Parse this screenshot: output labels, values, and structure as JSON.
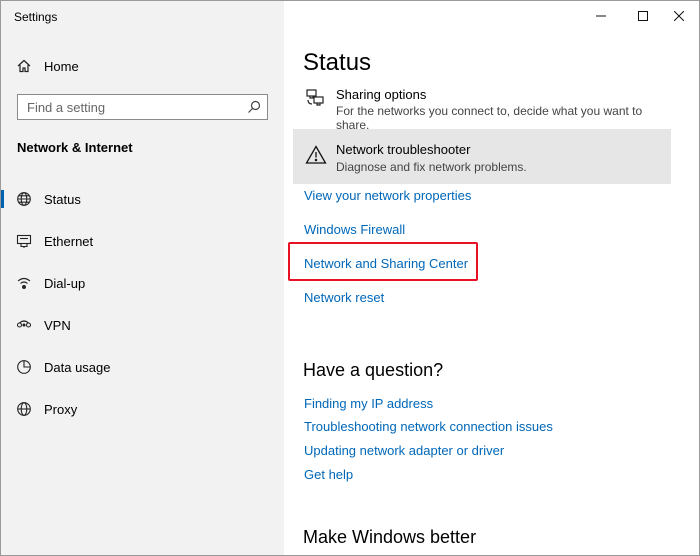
{
  "window": {
    "title": "Settings",
    "minimize_icon": "minimize-icon",
    "maximize_icon": "maximize-icon",
    "close_icon": "close-icon"
  },
  "sidebar": {
    "home_label": "Home",
    "search_placeholder": "Find a setting",
    "section_header": "Network & Internet",
    "items": [
      {
        "label": "Status",
        "icon": "globe-network-icon",
        "active": true
      },
      {
        "label": "Ethernet",
        "icon": "ethernet-icon"
      },
      {
        "label": "Dial-up",
        "icon": "dial-up-icon"
      },
      {
        "label": "VPN",
        "icon": "vpn-icon"
      },
      {
        "label": "Data usage",
        "icon": "data-usage-icon"
      },
      {
        "label": "Proxy",
        "icon": "proxy-globe-icon"
      }
    ]
  },
  "main": {
    "title": "Status",
    "sharing": {
      "title": "Sharing options",
      "desc": "For the networks you connect to, decide what you want to share."
    },
    "troubleshooter": {
      "title": "Network troubleshooter",
      "desc": "Diagnose and fix network problems."
    },
    "links": [
      "View your network properties",
      "Windows Firewall",
      "Network and Sharing Center",
      "Network reset"
    ],
    "question": {
      "heading": "Have a question?",
      "links": [
        "Finding my IP address",
        "Troubleshooting network connection issues",
        "Updating network adapter or driver",
        "Get help"
      ]
    },
    "better_heading": "Make Windows better"
  },
  "colors": {
    "link": "#0067b8",
    "accent": "#0063b1",
    "highlight": "#e81123",
    "sidebar_bg": "#f2f2f2",
    "hover_bg": "#e6e6e6"
  }
}
